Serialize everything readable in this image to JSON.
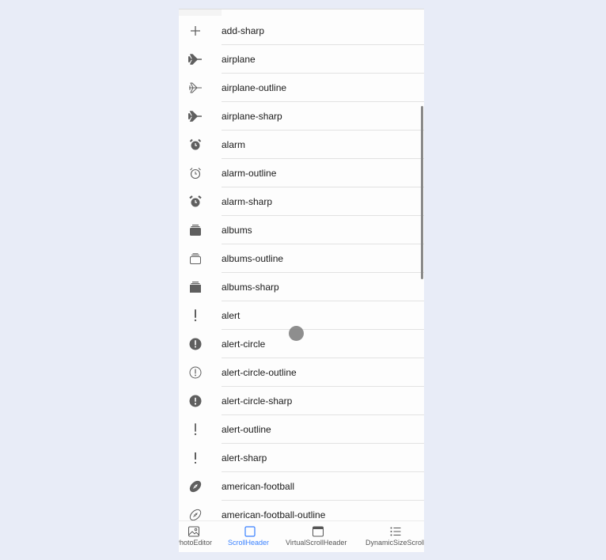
{
  "list": {
    "items": [
      {
        "label": "add-sharp",
        "icon": "add-icon"
      },
      {
        "label": "airplane",
        "icon": "airplane-icon"
      },
      {
        "label": "airplane-outline",
        "icon": "airplane-outline-icon"
      },
      {
        "label": "airplane-sharp",
        "icon": "airplane-sharp-icon"
      },
      {
        "label": "alarm",
        "icon": "alarm-icon"
      },
      {
        "label": "alarm-outline",
        "icon": "alarm-outline-icon"
      },
      {
        "label": "alarm-sharp",
        "icon": "alarm-sharp-icon"
      },
      {
        "label": "albums",
        "icon": "albums-icon"
      },
      {
        "label": "albums-outline",
        "icon": "albums-outline-icon"
      },
      {
        "label": "albums-sharp",
        "icon": "albums-sharp-icon"
      },
      {
        "label": "alert",
        "icon": "alert-icon"
      },
      {
        "label": "alert-circle",
        "icon": "alert-circle-icon"
      },
      {
        "label": "alert-circle-outline",
        "icon": "alert-circle-outline-icon"
      },
      {
        "label": "alert-circle-sharp",
        "icon": "alert-circle-sharp-icon"
      },
      {
        "label": "alert-outline",
        "icon": "alert-outline-icon"
      },
      {
        "label": "alert-sharp",
        "icon": "alert-sharp-icon"
      },
      {
        "label": "american-football",
        "icon": "american-football-icon"
      },
      {
        "label": "american-football-outline",
        "icon": "american-football-outline-icon"
      }
    ]
  },
  "tabs": [
    {
      "label": "PhotoEditor",
      "icon": "image-icon",
      "active": false
    },
    {
      "label": "ScrollHeader",
      "icon": "square-icon",
      "active": true
    },
    {
      "label": "VirtualScrollHeader",
      "icon": "browser-icon",
      "active": false
    },
    {
      "label": "DynamicSizeScroll",
      "icon": "list-icon",
      "active": false
    }
  ],
  "colors": {
    "active_tab": "#3880ff",
    "icon": "#5f5f5f",
    "background": "#e8ecf7"
  }
}
